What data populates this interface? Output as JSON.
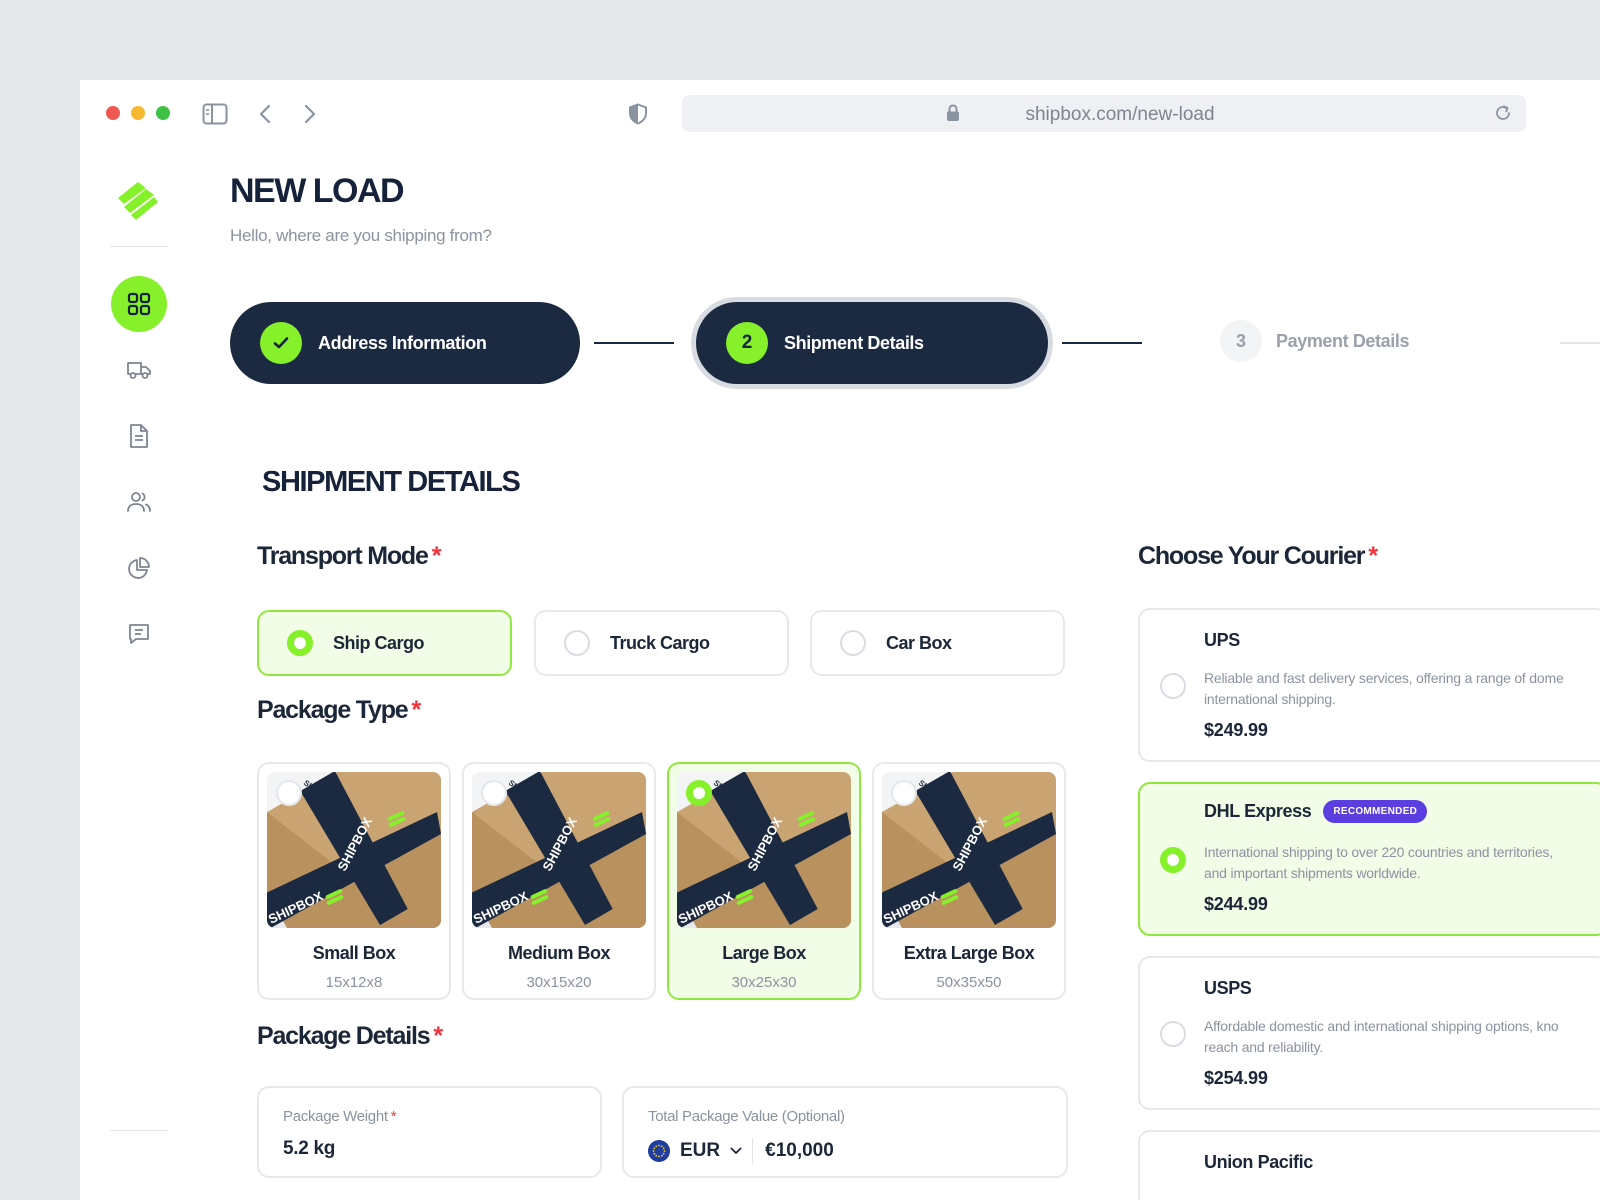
{
  "browser": {
    "url": "shipbox.com/new-load"
  },
  "header": {
    "title": "NEW LOAD",
    "subtitle": "Hello, where are you shipping from?"
  },
  "stepper": {
    "step1": {
      "label": "Address Information"
    },
    "step2": {
      "number": "2",
      "label": "Shipment Details"
    },
    "step3": {
      "number": "3",
      "label": "Payment Details"
    }
  },
  "section": {
    "title": "SHIPMENT DETAILS"
  },
  "transport": {
    "title": "Transport Mode",
    "required_mark": "*",
    "options": [
      {
        "label": "Ship Cargo",
        "selected": true
      },
      {
        "label": "Truck Cargo",
        "selected": false
      },
      {
        "label": "Car Box",
        "selected": false
      }
    ]
  },
  "package_type": {
    "title": "Package Type",
    "required_mark": "*",
    "items": [
      {
        "name": "Small Box",
        "dims": "15x12x8",
        "selected": false
      },
      {
        "name": "Medium Box",
        "dims": "30x15x20",
        "selected": false
      },
      {
        "name": "Large Box",
        "dims": "30x25x30",
        "selected": true
      },
      {
        "name": "Extra Large Box",
        "dims": "50x35x50",
        "selected": false
      }
    ],
    "box_print": "SHIPBOX"
  },
  "package_details": {
    "title": "Package Details",
    "required_mark": "*",
    "weight": {
      "label": "Package Weight",
      "required_mark": "*",
      "value": "5.2 kg"
    },
    "value": {
      "label": "Total Package Value (Optional)",
      "currency": "EUR",
      "amount": "€10,000"
    }
  },
  "courier": {
    "title": "Choose Your Courier",
    "required_mark": "*",
    "items": [
      {
        "name": "UPS",
        "desc_line1": "Reliable and fast delivery services, offering a range of dome",
        "desc_line2": "international shipping.",
        "price": "$249.99",
        "selected": false
      },
      {
        "name": "DHL Express",
        "badge": "RECOMMENDED",
        "desc_line1": "International shipping to over 220 countries and territories,",
        "desc_line2": "and important shipments worldwide.",
        "price": "$244.99",
        "selected": true
      },
      {
        "name": "USPS",
        "desc_line1": "Affordable domestic and international shipping options, kno",
        "desc_line2": "reach and reliability.",
        "price": "$254.99",
        "selected": false
      },
      {
        "name": "Union Pacific"
      }
    ]
  },
  "colors": {
    "accent": "#86f12a",
    "navy": "#1b2a40",
    "badge": "#5b3ee0",
    "required": "#f0333d"
  },
  "icons": {
    "nav": [
      "dashboard-icon",
      "truck-icon",
      "document-icon",
      "users-icon",
      "pie-chart-icon",
      "message-icon"
    ]
  }
}
